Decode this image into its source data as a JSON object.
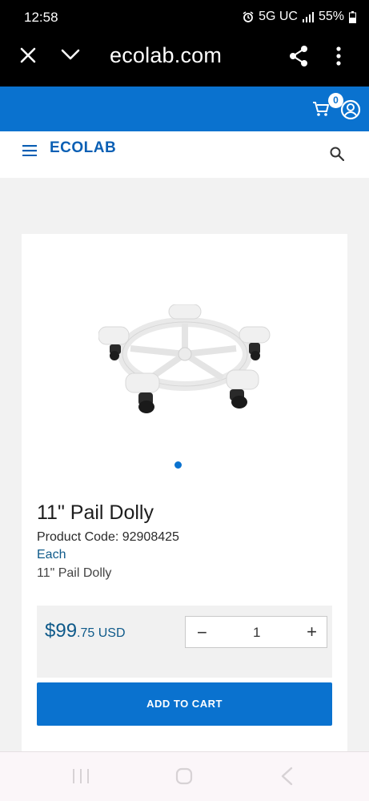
{
  "status_bar": {
    "time": "12:58",
    "network": "5G UC",
    "battery": "55%",
    "icons": [
      "alarm-icon",
      "signal-icon",
      "battery-icon"
    ]
  },
  "browser": {
    "url": "ecolab.com",
    "icons": [
      "close-icon",
      "chevron-down-icon",
      "share-icon",
      "more-vert-icon"
    ]
  },
  "utility_bar": {
    "cart_count": "0",
    "icons": [
      "cart-icon",
      "account-icon"
    ]
  },
  "header": {
    "logo_text": "ECOLAB",
    "icons": [
      "menu-icon",
      "search-icon"
    ]
  },
  "product": {
    "title": "11\" Pail Dolly",
    "code_label": "Product Code: 92908425",
    "unit": "Each",
    "description": "11\" Pail Dolly",
    "price_main": "$99",
    "price_cents": ".75 USD",
    "quantity": "1",
    "minus_label": "−",
    "plus_label": "+",
    "add_to_cart": "ADD TO CART",
    "carousel_active_index": 1,
    "carousel_total": 1
  },
  "nav_bar": {
    "icons": [
      "recents-icon",
      "home-icon",
      "back-icon"
    ]
  },
  "colors": {
    "brand_blue": "#0a72cf",
    "price_text": "#0f5a8a",
    "logo_blue": "#0a5fb4"
  }
}
